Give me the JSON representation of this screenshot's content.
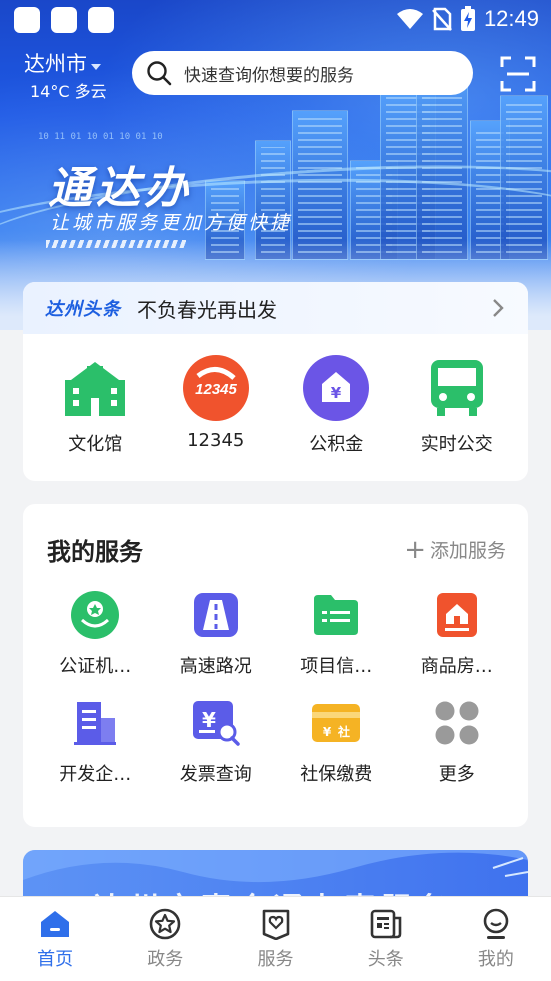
{
  "status_bar": {
    "time": "12:49"
  },
  "header": {
    "city": "达州市",
    "weather": "14°C 多云",
    "search_placeholder": "快速查询你想要的服务"
  },
  "hero": {
    "title": "通达办",
    "subtitle": "让城市服务更加方便快捷",
    "binary_text": "10 11 01 10 01 10 01 10"
  },
  "news": {
    "tag": "达州头条",
    "headline": "不负春光再出发"
  },
  "quick_entries": [
    {
      "label": "文化馆",
      "icon": "museum-icon",
      "color": "#2bbf6a"
    },
    {
      "label": "12345",
      "icon": "hotline-12345-icon",
      "color": "#f0532d"
    },
    {
      "label": "公积金",
      "icon": "housing-fund-icon",
      "color": "#6b55e6"
    },
    {
      "label": "实时公交",
      "icon": "bus-icon",
      "color": "#2bbf6a"
    }
  ],
  "my_services": {
    "title": "我的服务",
    "add_label": "添加服务",
    "items": [
      {
        "label": "公证机…",
        "icon": "notary-icon",
        "color": "#2bbf6a"
      },
      {
        "label": "高速路况",
        "icon": "highway-icon",
        "color": "#5b5ce8"
      },
      {
        "label": "项目信…",
        "icon": "project-folder-icon",
        "color": "#2bbf6a"
      },
      {
        "label": "商品房…",
        "icon": "house-icon",
        "color": "#f0532d"
      },
      {
        "label": "开发企…",
        "icon": "enterprise-building-icon",
        "color": "#5b5ce8"
      },
      {
        "label": "发票查询",
        "icon": "invoice-search-icon",
        "color": "#5b5ce8"
      },
      {
        "label": "社保缴费",
        "icon": "social-security-card-icon",
        "color": "#f5b324"
      },
      {
        "label": "更多",
        "icon": "more-dots-icon",
        "color": "#9a9a9a"
      }
    ]
  },
  "banner": {
    "text": "达州市惠企通办事服务"
  },
  "tabbar": {
    "active": 0,
    "tabs": [
      {
        "label": "首页",
        "icon": "home-icon"
      },
      {
        "label": "政务",
        "icon": "star-circle-icon"
      },
      {
        "label": "服务",
        "icon": "heart-box-icon"
      },
      {
        "label": "头条",
        "icon": "newspaper-icon"
      },
      {
        "label": "我的",
        "icon": "profile-icon"
      }
    ]
  }
}
